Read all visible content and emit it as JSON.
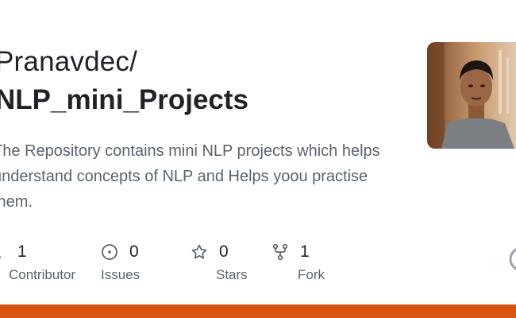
{
  "repo": {
    "owner": "Pranavdec/",
    "name": "NLP_mini_Projects",
    "description": "The Repository contains mini NLP projects which helps understand concepts of NLP and Helps yoou practise them."
  },
  "stats": [
    {
      "icon": "people-icon",
      "count": "1",
      "label": "Contributor"
    },
    {
      "icon": "issue-icon",
      "count": "0",
      "label": "Issues"
    },
    {
      "icon": "star-icon",
      "count": "0",
      "label": "Stars"
    },
    {
      "icon": "fork-icon",
      "count": "1",
      "label": "Fork"
    }
  ],
  "colors": {
    "bottom_bar": "#d9540f",
    "text_primary": "#1f2328",
    "text_muted": "#59636e"
  }
}
